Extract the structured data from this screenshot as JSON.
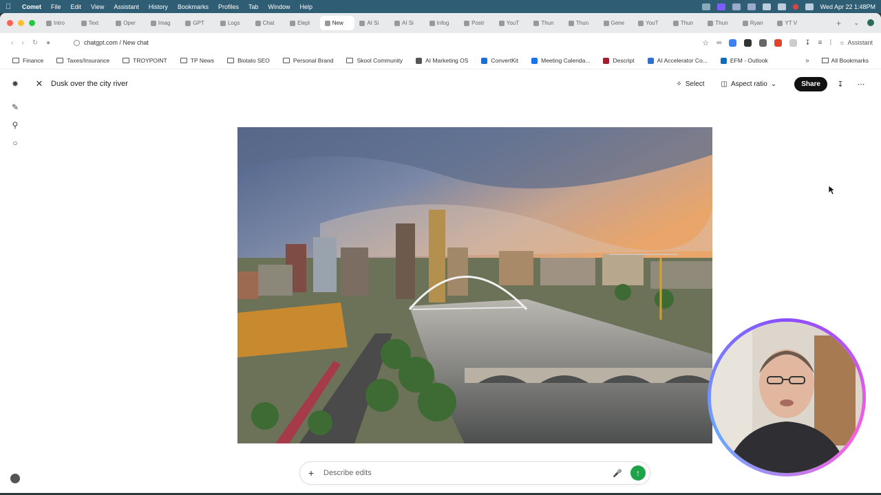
{
  "menubar": {
    "app_name": "Comet",
    "items": [
      "File",
      "Edit",
      "View",
      "Assistant",
      "History",
      "Bookmarks",
      "Profiles",
      "Tab",
      "Window",
      "Help"
    ],
    "datetime": "Wed Apr 22  1:48PM"
  },
  "tabs": [
    {
      "label": "Intro"
    },
    {
      "label": "Text"
    },
    {
      "label": "Oper"
    },
    {
      "label": "Imag"
    },
    {
      "label": "GPT"
    },
    {
      "label": "Logs"
    },
    {
      "label": "Chat"
    },
    {
      "label": "Elepl"
    },
    {
      "label": "New",
      "active": true
    },
    {
      "label": "AI Si"
    },
    {
      "label": "AI Si"
    },
    {
      "label": "Infog"
    },
    {
      "label": "Postr"
    },
    {
      "label": "YouT"
    },
    {
      "label": "Thun"
    },
    {
      "label": "Thun"
    },
    {
      "label": "Gene"
    },
    {
      "label": "YouT"
    },
    {
      "label": "Thun"
    },
    {
      "label": "Thun"
    },
    {
      "label": "Ryan"
    },
    {
      "label": "YT V"
    }
  ],
  "toolbar": {
    "url": "chatgpt.com / New chat",
    "assistant_label": "Assistant"
  },
  "bookmarks": {
    "items": [
      {
        "label": "Finance",
        "type": "folder"
      },
      {
        "label": "Taxes/Insurance",
        "type": "folder"
      },
      {
        "label": "TROYPOINT",
        "type": "folder"
      },
      {
        "label": "TP News",
        "type": "folder"
      },
      {
        "label": "Biotato SEO",
        "type": "folder"
      },
      {
        "label": "Personal Brand",
        "type": "folder"
      },
      {
        "label": "Skool Community",
        "type": "folder"
      },
      {
        "label": "AI Marketing OS",
        "type": "site",
        "color": "#555555"
      },
      {
        "label": "ConvertKit",
        "type": "site",
        "color": "#1a6fd6"
      },
      {
        "label": "Meeting Calenda...",
        "type": "site",
        "color": "#1a73e8"
      },
      {
        "label": "Descript",
        "type": "site",
        "color": "#a11f2e"
      },
      {
        "label": "AI Accelerator Co...",
        "type": "site",
        "color": "#2f6fd8"
      },
      {
        "label": "EFM - Outlook",
        "type": "site",
        "color": "#0f6cbd"
      }
    ],
    "all_label": "All Bookmarks"
  },
  "editor": {
    "title": "Dusk over the city river",
    "select_label": "Select",
    "aspect_label": "Aspect ratio",
    "share_label": "Share"
  },
  "composer": {
    "placeholder": "Describe edits"
  },
  "colors": {
    "menubar_bg": "#2f5d74",
    "send_button": "#1ea446",
    "share_button": "#111111"
  }
}
